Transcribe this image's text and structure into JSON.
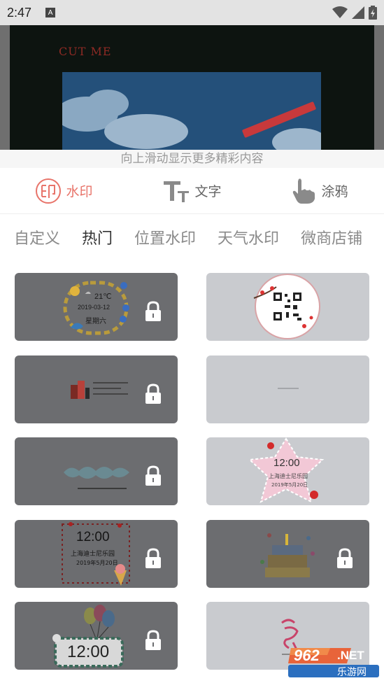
{
  "status_bar": {
    "time": "2:47",
    "notification_letter": "A"
  },
  "preview": {
    "title_text": "CUT ME"
  },
  "hint": "向上滑动显示更多精彩内容",
  "tools": [
    {
      "label": "水印",
      "icon": "seal-icon",
      "active": true
    },
    {
      "label": "文字",
      "icon": "text-icon",
      "active": false
    },
    {
      "label": "涂鸦",
      "icon": "hand-icon",
      "active": false
    }
  ],
  "tabs": [
    "自定义",
    "热门",
    "位置水印",
    "天气水印",
    "微商店铺"
  ],
  "active_tab": "热门",
  "templates": [
    {
      "id": "weather",
      "style": "dark",
      "locked": true,
      "texts": [
        "21℃",
        "2019-03-12",
        "星期六"
      ]
    },
    {
      "id": "qrcode",
      "style": "light",
      "locked": false,
      "texts": []
    },
    {
      "id": "shop-products",
      "style": "dark",
      "locked": true,
      "texts": []
    },
    {
      "id": "blank-date",
      "style": "light",
      "locked": false,
      "texts": []
    },
    {
      "id": "art-text",
      "style": "dark",
      "locked": true,
      "texts": []
    },
    {
      "id": "star-time",
      "style": "light",
      "locked": false,
      "texts": [
        "12:00",
        "上海迪士尼乐园",
        "2019年5月20日"
      ]
    },
    {
      "id": "flower-time",
      "style": "dark",
      "locked": true,
      "texts": [
        "12:00",
        "上海迪士尼乐园",
        "2019年5月20日"
      ]
    },
    {
      "id": "birthday-cake",
      "style": "dark",
      "locked": true,
      "texts": []
    },
    {
      "id": "balloon-clock",
      "style": "dark",
      "locked": true,
      "texts": [
        "12:00"
      ]
    },
    {
      "id": "calligraphy",
      "style": "light",
      "locked": false,
      "texts": []
    }
  ],
  "brand": {
    "number": "962",
    "suffix": ".NET",
    "subtitle": "乐游网"
  },
  "colors": {
    "accent": "#e8746a",
    "card_dark": "#6c6d70",
    "card_light": "#c9cbcf"
  }
}
